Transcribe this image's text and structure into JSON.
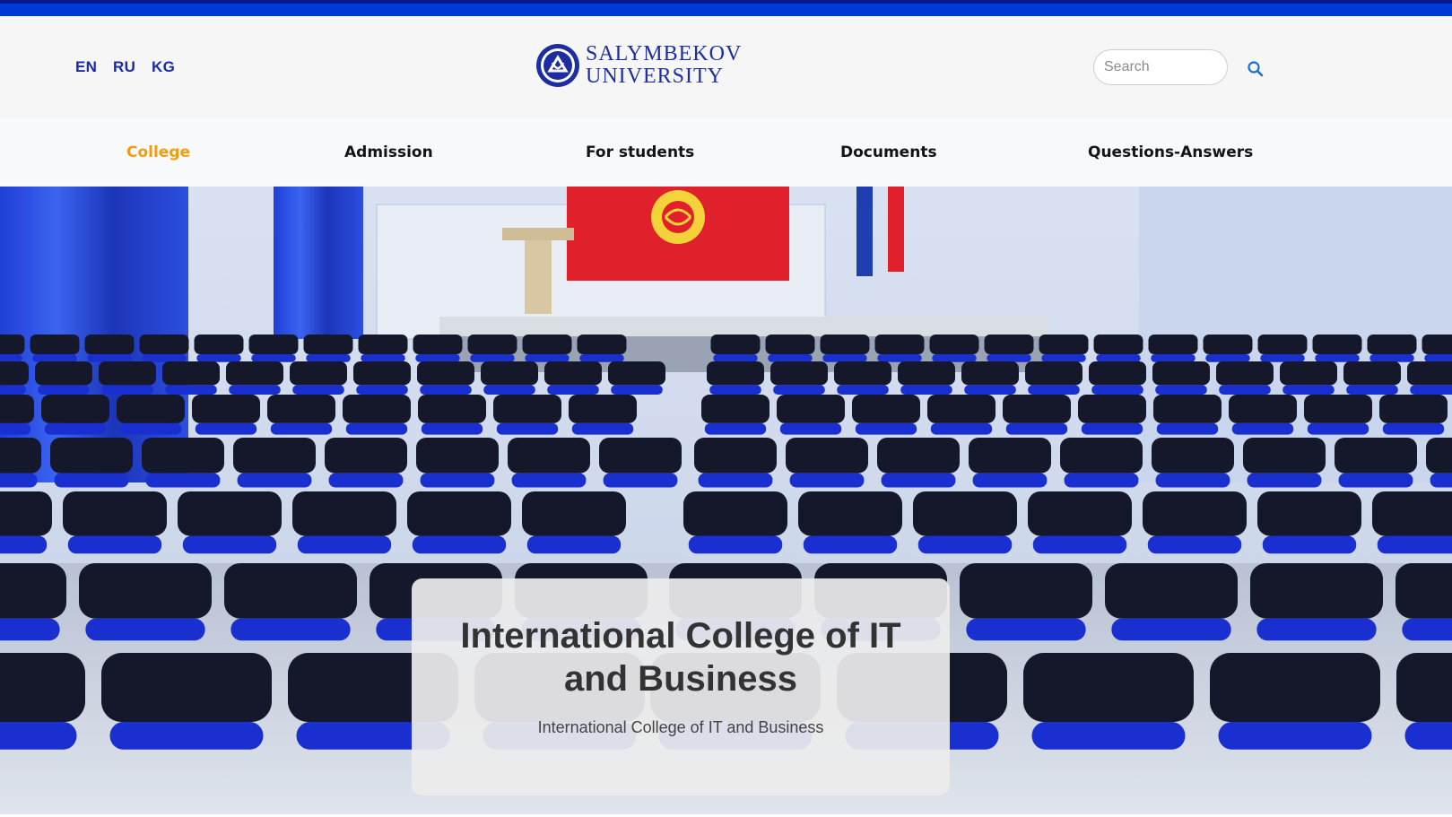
{
  "languages": [
    "EN",
    "RU",
    "KG"
  ],
  "logo": {
    "line1": "SALYMBEKOV",
    "line2": "UNIVERSITY"
  },
  "search": {
    "placeholder": "Search",
    "icon": "search-icon"
  },
  "nav": {
    "items": [
      {
        "label": "College",
        "active": true
      },
      {
        "label": "Admission",
        "active": false
      },
      {
        "label": "For students",
        "active": false
      },
      {
        "label": "Documents",
        "active": false
      },
      {
        "label": "Questions-Answers",
        "active": false
      }
    ]
  },
  "hero": {
    "title": "International College of IT and Business",
    "subtitle": "International College of IT and Business"
  },
  "colors": {
    "top_bar": "#003ad6",
    "brand_blue": "#1d2fa0",
    "active_nav": "#f39c12",
    "chair_blue": "#1a2fd0"
  }
}
